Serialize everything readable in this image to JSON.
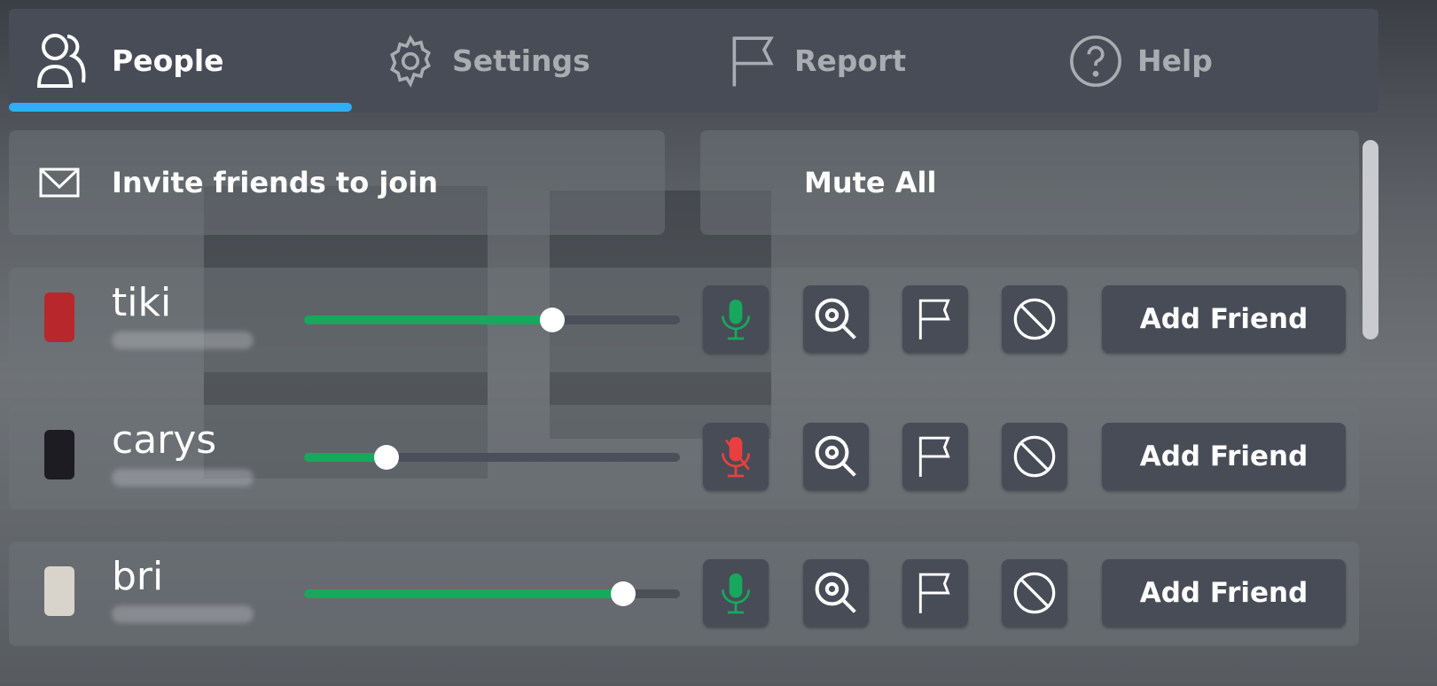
{
  "tabs": [
    {
      "label": "People",
      "icon": "people-icon",
      "active": true
    },
    {
      "label": "Settings",
      "icon": "gear-icon"
    },
    {
      "label": "Report",
      "icon": "flag-icon"
    },
    {
      "label": "Help",
      "icon": "help-icon"
    }
  ],
  "actions": {
    "invite_label": "Invite friends to join",
    "mute_all_label": "Mute All"
  },
  "players": [
    {
      "name": "tiki",
      "volume": 0.66,
      "mic": "on",
      "add_friend": "Add Friend"
    },
    {
      "name": "carys",
      "volume": 0.22,
      "mic": "muted",
      "add_friend": "Add Friend"
    },
    {
      "name": "bri",
      "volume": 0.85,
      "mic": "on",
      "add_friend": "Add Friend"
    }
  ],
  "colors": {
    "accent": "#2eaef5",
    "mic_on": "#17a85d",
    "mic_muted": "#e8403f",
    "slider_fill": "#17a85d"
  }
}
